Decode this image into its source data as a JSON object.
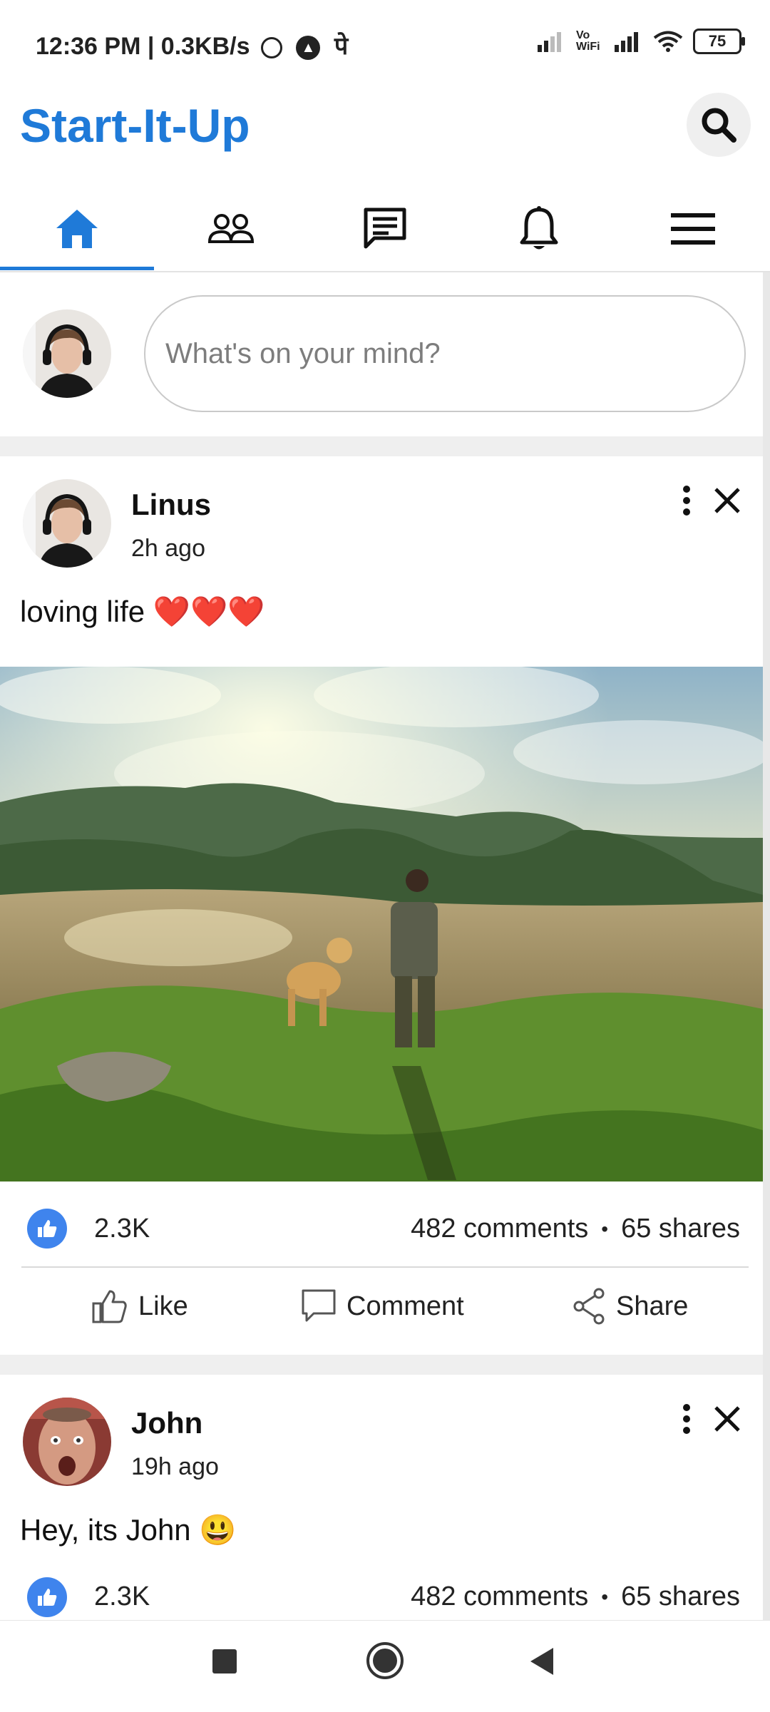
{
  "status_bar": {
    "time": "12:36 PM | 0.3KB/s",
    "extra_glyph": "पे",
    "network": "Vo WiFi",
    "battery": "75"
  },
  "app": {
    "title": "Start-It-Up",
    "accent_color": "#1f7ad8"
  },
  "nav": {
    "tabs": [
      {
        "icon": "home-icon",
        "active": true
      },
      {
        "icon": "friends-icon",
        "active": false
      },
      {
        "icon": "messages-icon",
        "active": false
      },
      {
        "icon": "bell-icon",
        "active": false
      },
      {
        "icon": "menu-icon",
        "active": false
      }
    ]
  },
  "composer": {
    "placeholder": "What's on your mind?"
  },
  "posts": [
    {
      "author": "Linus",
      "time": "2h ago",
      "text": "loving life ❤️❤️❤️",
      "likes": "2.3K",
      "comments": "482 comments",
      "shares": "65 shares",
      "has_image": true
    },
    {
      "author": "John",
      "time": "19h ago",
      "text": "Hey, its John 😃",
      "likes": "2.3K",
      "comments": "482 comments",
      "shares": "65 shares",
      "has_image": false
    }
  ],
  "actions": {
    "like": "Like",
    "comment": "Comment",
    "share": "Share",
    "dot": "•"
  }
}
